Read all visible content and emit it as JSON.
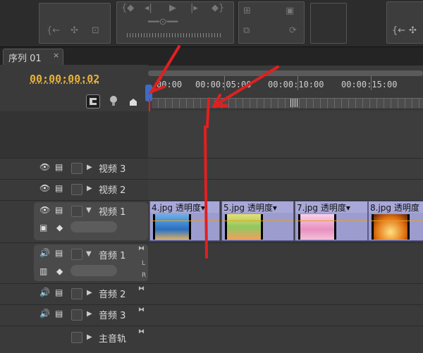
{
  "colors": {
    "timecode": "#e8b23a",
    "annotation": "#e02020",
    "clip": "#9c9ccf",
    "playhead": "#ff2020"
  },
  "tab": {
    "label": "序列 01",
    "close": "×"
  },
  "timecode": "00:00:00:02",
  "ruler": {
    "labels": [
      "00:00",
      "00:00:05:00",
      "00:00:10:00",
      "00:00:15:00"
    ]
  },
  "tracks": {
    "video3": "视频 3",
    "video2": "视频 2",
    "video1": "视频 1",
    "audio1": "音频 1",
    "audio2": "音频 2",
    "audio3": "音频 3",
    "master": "主音轨"
  },
  "clips": [
    {
      "name": "4.jpg  透明度▾"
    },
    {
      "name": "5.jpg  透明度▾"
    },
    {
      "name": "7.jpg  透明度▾"
    },
    {
      "name": "8.jpg  透明度"
    }
  ],
  "lr": {
    "l": "L",
    "r": "R"
  },
  "icons": [
    "eye-icon",
    "film-icon",
    "speaker-icon",
    "wrench-icon",
    "marker-icon",
    "snap-icon",
    "keyframe-icon"
  ]
}
